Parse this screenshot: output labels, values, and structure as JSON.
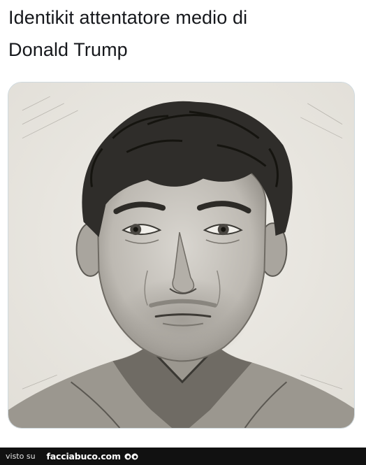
{
  "post": {
    "line1": "Identikit attentatore medio di",
    "line2": "Donald Trump"
  },
  "media": {
    "icon": "pencil-sketch-portrait",
    "paper_color": "#ebe9e4"
  },
  "footer": {
    "visto_label": "visto su",
    "brand_label": "facciabuco.com",
    "logo_icon": "eyes-logo-icon",
    "bar_color": "#111111"
  }
}
